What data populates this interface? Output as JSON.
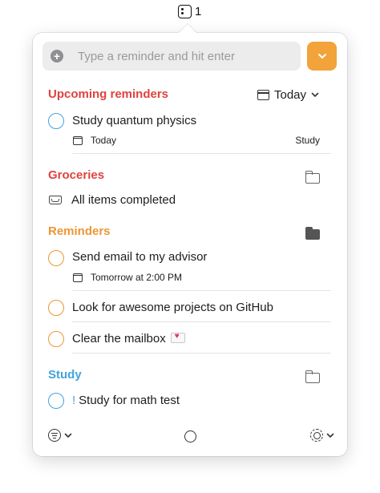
{
  "menubar": {
    "count": "1",
    "icon": "reminders-menubar-icon"
  },
  "input": {
    "placeholder": "Type a reminder and hit enter",
    "value": "",
    "add_icon": "plus-circle-icon",
    "dropdown_icon": "chevron-down-icon"
  },
  "sections": [
    {
      "title": "Upcoming reminders",
      "color": "#e0423e",
      "filter": {
        "label": "Today",
        "icon": "calendar-icon"
      },
      "items": [
        {
          "text": "Study quantum physics",
          "date": "Today",
          "list": "Study",
          "circle_color": "#43a3dd"
        }
      ]
    },
    {
      "title": "Groceries",
      "color": "#e0423e",
      "folder_icon": "folder-outline-icon",
      "status": "All items completed"
    },
    {
      "title": "Reminders",
      "color": "#ef9535",
      "folder_icon": "folder-filled-icon",
      "items": [
        {
          "text": "Send email to my advisor",
          "date": "Tomorrow at 2:00 PM",
          "circle_color": "#ef9535"
        },
        {
          "text": "Look for awesome projects on GitHub",
          "circle_color": "#ef9535"
        },
        {
          "text": "Clear the mailbox",
          "emoji": "love-letter",
          "circle_color": "#ef9535"
        }
      ]
    },
    {
      "title": "Study",
      "color": "#43a3dd",
      "folder_icon": "folder-outline-icon",
      "items": [
        {
          "text": "Study for math test",
          "priority": "!",
          "circle_color": "#43a3dd"
        }
      ]
    }
  ],
  "footer": {
    "filter_icon": "filter-icon",
    "center_icon": "circle-icon",
    "settings_icon": "gear-icon"
  }
}
